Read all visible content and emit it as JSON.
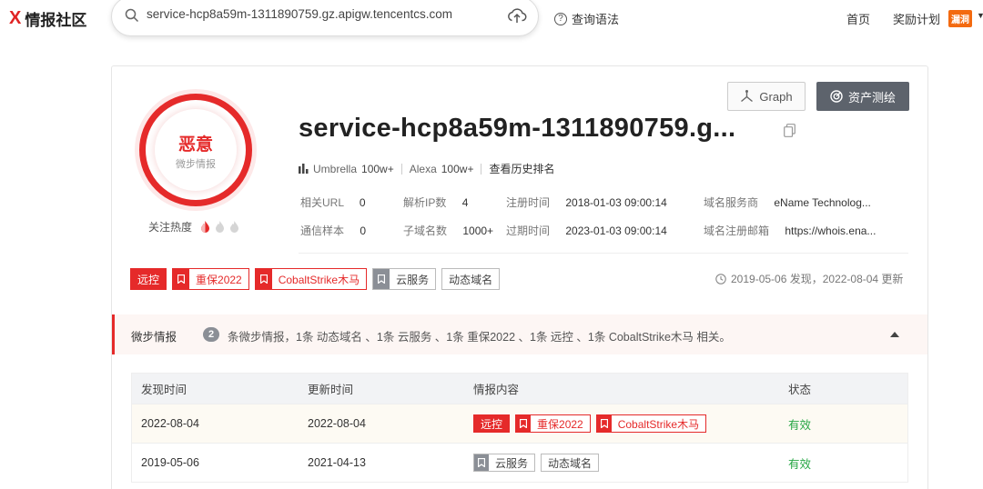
{
  "nav": {
    "logo_mark": "X",
    "logo_text": "情报社区",
    "search_value": "service-hcp8a59m-1311890759.gz.apigw.tencentcs.com",
    "syntax_label": "查询语法",
    "home_label": "首页",
    "reward_label": "奖励计划",
    "badge_label": "漏洞"
  },
  "verdict": {
    "label": "恶意",
    "source": "微步情报",
    "heat_label": "关注热度"
  },
  "domain": {
    "title": "service-hcp8a59m-1311890759.g..."
  },
  "actions": {
    "graph_label": "Graph",
    "survey_label": "资产测绘"
  },
  "rank": {
    "umbrella_label": "Umbrella",
    "umbrella_value": "100w+",
    "alexa_label": "Alexa",
    "alexa_value": "100w+",
    "history_label": "查看历史排名"
  },
  "info": {
    "related_url_label": "相关URL",
    "related_url_value": "0",
    "resolve_ip_label": "解析IP数",
    "resolve_ip_value": "4",
    "reg_time_label": "注册时间",
    "reg_time_value": "2018-01-03 09:00:14",
    "registrar_label": "域名服务商",
    "registrar_value": "eName Technolog...",
    "samples_label": "通信样本",
    "samples_value": "0",
    "subdomain_label": "子域名数",
    "subdomain_value": "1000+",
    "expire_label": "过期时间",
    "expire_value": "2023-01-03 09:00:14",
    "reg_email_label": "域名注册邮箱",
    "reg_email_value": "https://whois.ena..."
  },
  "tags": [
    "远控",
    "重保2022",
    "CobaltStrike木马",
    "云服务",
    "动态域名"
  ],
  "timeline": "2019-05-06 发现，2022-08-04 更新",
  "intel": {
    "label": "微步情报",
    "count": "2",
    "summary": "条微步情报，1条 动态域名 、1条 云服务 、1条 重保2022 、1条 远控 、1条 CobaltStrike木马 相关。"
  },
  "table": {
    "headers": [
      "发现时间",
      "更新时间",
      "情报内容",
      "状态"
    ],
    "rows": [
      {
        "found": "2022-08-04",
        "updated": "2022-08-04",
        "tags": [
          "远控",
          "重保2022",
          "CobaltStrike木马"
        ],
        "status": "有效"
      },
      {
        "found": "2019-05-06",
        "updated": "2021-04-13",
        "tags": [
          "云服务",
          "动态域名"
        ],
        "status": "有效"
      }
    ]
  },
  "colors": {
    "danger": "#e52a2a",
    "status_ok": "#28a745",
    "survey_btn": "#5d636c",
    "badge": "#f36a10"
  }
}
